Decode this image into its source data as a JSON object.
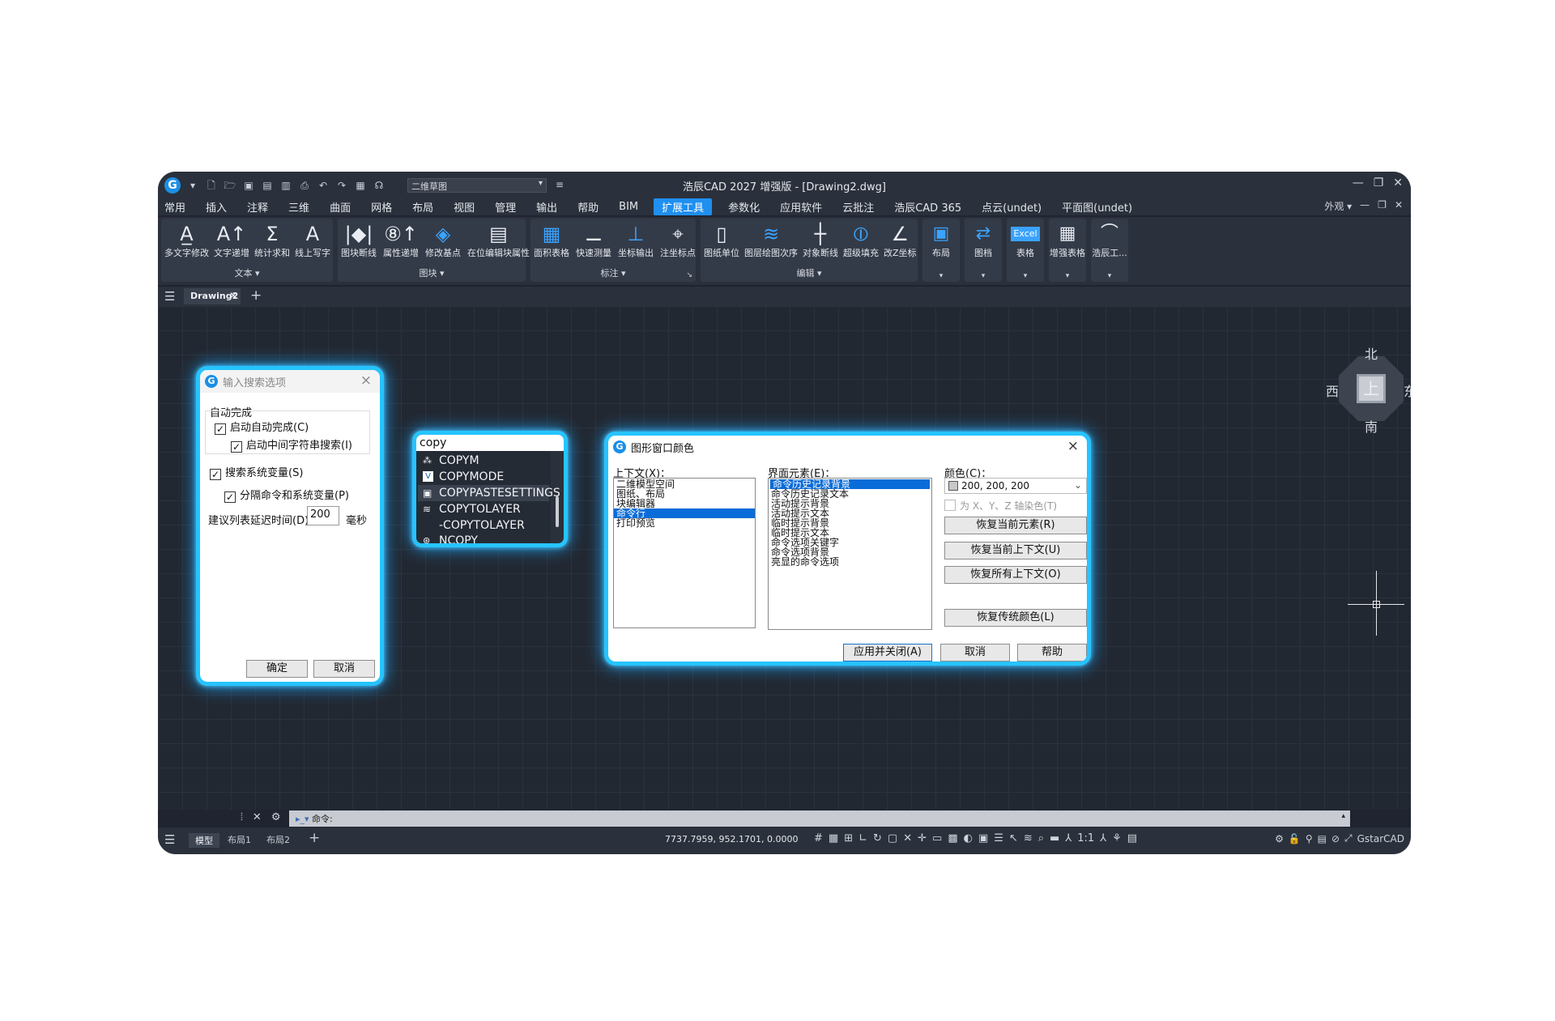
{
  "app": {
    "title": "浩辰CAD 2027 增强版 - [Drawing2.dwg]",
    "workspace": "二维草图",
    "logo": "G"
  },
  "menu": {
    "items": [
      "常用",
      "插入",
      "注释",
      "三维",
      "曲面",
      "网格",
      "布局",
      "视图",
      "管理",
      "输出",
      "帮助",
      "BIM",
      "扩展工具",
      "参数化",
      "应用软件",
      "云批注",
      "浩辰CAD 365",
      "点云(undet)",
      "平面图(undet)"
    ],
    "active": "扩展工具",
    "right_label": "外观"
  },
  "ribbon": {
    "text_panel": {
      "title": "文本 ▾",
      "tools": [
        "多文字修改",
        "文字递增",
        "统计求和",
        "线上写字"
      ]
    },
    "block_panel": {
      "title": "图块 ▾",
      "tools": [
        "图块断线",
        "属性递增",
        "修改基点",
        "在位编辑块属性"
      ]
    },
    "dim_panel": {
      "title": "标注 ▾",
      "tools": [
        "面积表格",
        "快速测量",
        "坐标输出",
        "注坐标点"
      ]
    },
    "edit_panel": {
      "title": "编辑 ▾",
      "tools": [
        "图纸单位",
        "图层绘图次序",
        "对象断线",
        "超级填充",
        "改Z坐标"
      ]
    },
    "singles": [
      "布局",
      "图档",
      "表格",
      "增强表格",
      "浩辰工..."
    ],
    "excel_badge": "Excel"
  },
  "doc_tab": {
    "name": "Drawing2"
  },
  "viewcube": {
    "north": "北",
    "south": "南",
    "east": "东",
    "west": "西",
    "face": "上"
  },
  "search_dialog": {
    "title": "输入搜索选项",
    "group_label": "自动完成",
    "opt_autocomplete": "启动自动完成(C)",
    "opt_midstring": "启动中间字符串搜索(I)",
    "opt_sysvars": "搜索系统变量(S)",
    "opt_separate": "分隔命令和系统变量(P)",
    "delay_label": "建议列表延迟时间(D)",
    "delay_value": "200",
    "delay_unit": "毫秒",
    "ok": "确定",
    "cancel": "取消"
  },
  "autocomplete": {
    "query": "copy",
    "items": [
      "COPYM",
      "COPYMODE",
      "COPYPASTESETTINGS",
      "COPYTOLAYER",
      "-COPYTOLAYER",
      "NCOPY"
    ],
    "item_icon": "V"
  },
  "color_dialog": {
    "title": "图形窗口颜色",
    "context_label": "上下文(X)：",
    "contexts": [
      "二维模型空间",
      "图纸、布局",
      "块编辑器",
      "命令行",
      "打印预览"
    ],
    "context_selected": 3,
    "elements_label": "界面元素(E)：",
    "elements": [
      "命令历史记录背景",
      "命令历史记录文本",
      "活动提示背景",
      "活动提示文本",
      "临时提示背景",
      "临时提示文本",
      "命令选项关键字",
      "命令选项背景",
      "亮显的命令选项"
    ],
    "element_selected": 0,
    "color_label": "颜色(C)：",
    "color_value": "200, 200, 200",
    "tint_label": "为 X、Y、Z 轴染色(T)",
    "restore_element": "恢复当前元素(R)",
    "restore_context": "恢复当前上下文(U)",
    "restore_all": "恢复所有上下文(O)",
    "restore_classic": "恢复传统颜色(L)",
    "apply_close": "应用并关闭(A)",
    "cancel": "取消",
    "help": "帮助"
  },
  "command": {
    "prompt": "命令:"
  },
  "status": {
    "tabs": [
      "模型",
      "布局1",
      "布局2"
    ],
    "coords": "7737.7959, 952.1701, 0.0000",
    "scale": "1:1",
    "brand": "GstarCAD"
  },
  "colors": {
    "accent": "#1f8ff0",
    "glow": "#26c4ff",
    "bg": "#1f2430"
  }
}
